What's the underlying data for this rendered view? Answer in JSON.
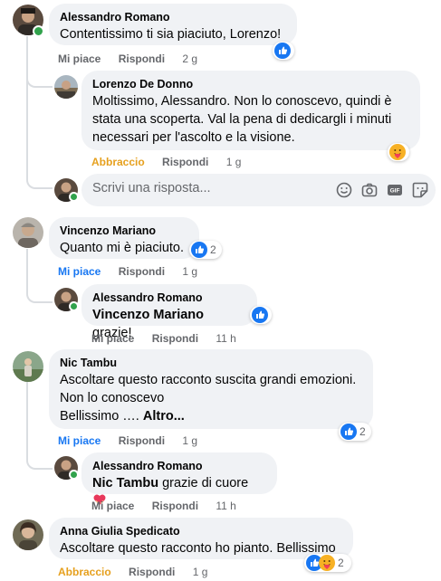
{
  "comments": [
    {
      "author": "Alessandro Romano",
      "text": "Contentissimo ti sia piaciuto, Lorenzo!",
      "like_label": "Mi piace",
      "reply_label": "Rispondi",
      "time": "2 g",
      "reactions": {
        "icons": [
          "like"
        ],
        "count": ""
      },
      "replies": [
        {
          "author": "Lorenzo De Donno",
          "text_lines": [
            "Moltissimo, Alessandro. Non lo conoscevo, quindi è",
            "stata una scoperta. Val la pena di dedicargli i minuti",
            "necessari per l'ascolto e la visione."
          ],
          "like_label": "Abbraccio",
          "reply_label": "Rispondi",
          "time": "1 g",
          "reactions": {
            "icons": [
              "care"
            ],
            "count": ""
          }
        }
      ]
    },
    {
      "author": "Vincenzo Mariano",
      "text": "Quanto mi è piaciuto.",
      "like_label": "Mi piace",
      "reply_label": "Rispondi",
      "time": "1 g",
      "reactions": {
        "icons": [
          "like"
        ],
        "count": "2"
      },
      "replies": [
        {
          "author": "Alessandro Romano",
          "mention": "Vincenzo Mariano",
          "text": " grazie!",
          "like_label": "Mi piace",
          "reply_label": "Rispondi",
          "time": "11 h",
          "reactions": {
            "icons": [
              "like"
            ],
            "count": ""
          }
        }
      ]
    },
    {
      "author": "Nic Tambu",
      "text_lines": [
        "Ascoltare questo racconto suscita grandi emozioni.",
        "Non lo conoscevo",
        "Bellissimo …."
      ],
      "more_label": "Altro...",
      "like_label": "Mi piace",
      "reply_label": "Rispondi",
      "time": "1 g",
      "reactions": {
        "icons": [
          "like"
        ],
        "count": "2"
      },
      "replies": [
        {
          "author": "Alessandro Romano",
          "mention": "Nic Tambu",
          "text": " grazie di cuore",
          "like_label": "Mi piace",
          "reply_label": "Rispondi",
          "time": "11 h",
          "reactions": {
            "icons": [],
            "count": ""
          }
        }
      ]
    },
    {
      "author": "Anna Giulia Spedicato",
      "text": "Ascoltare questo racconto ho pianto. Bellissimo",
      "like_label": "Abbraccio",
      "reply_label": "Rispondi",
      "time": "1 g",
      "reactions": {
        "icons": [
          "like",
          "care"
        ],
        "count": "2"
      }
    }
  ],
  "reply_box": {
    "placeholder": "Scrivi una risposta..."
  },
  "icons": {
    "reply_tools": [
      "emoji-icon",
      "camera-icon",
      "gif-icon",
      "sticker-icon"
    ],
    "inline_emoji": "heart-hands-emoji"
  },
  "colors": {
    "accent": "#1877f2",
    "care": "#f7b125",
    "bubble": "#f0f2f5",
    "meta": "#65676b",
    "online": "#31a24c"
  }
}
